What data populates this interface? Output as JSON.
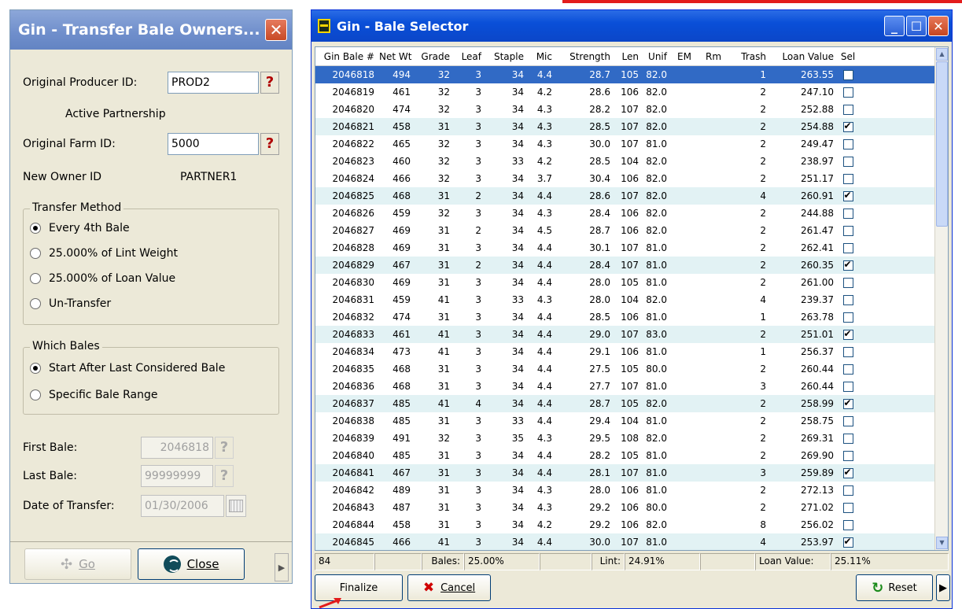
{
  "transfer_window": {
    "title": "Gin - Transfer Bale Owners...",
    "close_glyph": "✕",
    "original_producer_label": "Original Producer ID:",
    "original_producer_value": "PROD2",
    "partnership_text": "Active Partnership",
    "original_farm_label": "Original Farm ID:",
    "original_farm_value": "5000",
    "new_owner_label": "New Owner ID",
    "new_owner_value": "PARTNER1",
    "lookup_glyph": "?",
    "transfer_method": {
      "legend": "Transfer Method",
      "options": [
        "Every 4th Bale",
        "25.000% of Lint Weight",
        "25.000% of Loan Value",
        "Un-Transfer"
      ],
      "selected_index": 0
    },
    "which_bales": {
      "legend": "Which Bales",
      "options": [
        "Start After Last Considered Bale",
        "Specific Bale Range"
      ],
      "selected_index": 0
    },
    "first_bale_label": "First Bale:",
    "first_bale_value": "2046818",
    "last_bale_label": "Last Bale:",
    "last_bale_value": "99999999",
    "date_label": "Date of Transfer:",
    "date_value": "01/30/2006",
    "go_label": "Go",
    "close_label": "Close"
  },
  "selector_window": {
    "title": "Gin - Bale Selector",
    "columns": [
      "Gin Bale #",
      "Net Wt",
      "Grade",
      "Leaf",
      "Staple",
      "Mic",
      "Strength",
      "Len",
      "Unif",
      "EM",
      "Rm",
      "Trash",
      "Loan Value",
      "Sel"
    ],
    "rows": [
      [
        "2046818",
        "494",
        "32",
        "3",
        "34",
        "4.4",
        "28.7",
        "105",
        "82.0",
        "",
        "",
        "1",
        "263.55",
        false
      ],
      [
        "2046819",
        "461",
        "32",
        "3",
        "34",
        "4.2",
        "28.6",
        "106",
        "82.0",
        "",
        "",
        "2",
        "247.10",
        false
      ],
      [
        "2046820",
        "474",
        "32",
        "3",
        "34",
        "4.3",
        "28.2",
        "107",
        "82.0",
        "",
        "",
        "2",
        "252.88",
        false
      ],
      [
        "2046821",
        "458",
        "31",
        "3",
        "34",
        "4.3",
        "28.5",
        "107",
        "82.0",
        "",
        "",
        "2",
        "254.88",
        true
      ],
      [
        "2046822",
        "465",
        "32",
        "3",
        "34",
        "4.3",
        "30.0",
        "107",
        "81.0",
        "",
        "",
        "2",
        "249.47",
        false
      ],
      [
        "2046823",
        "460",
        "32",
        "3",
        "33",
        "4.2",
        "28.5",
        "104",
        "82.0",
        "",
        "",
        "2",
        "238.97",
        false
      ],
      [
        "2046824",
        "466",
        "32",
        "3",
        "34",
        "3.7",
        "30.4",
        "106",
        "82.0",
        "",
        "",
        "2",
        "251.17",
        false
      ],
      [
        "2046825",
        "468",
        "31",
        "2",
        "34",
        "4.4",
        "28.6",
        "107",
        "82.0",
        "",
        "",
        "4",
        "260.91",
        true
      ],
      [
        "2046826",
        "459",
        "32",
        "3",
        "34",
        "4.3",
        "28.4",
        "106",
        "82.0",
        "",
        "",
        "2",
        "244.88",
        false
      ],
      [
        "2046827",
        "469",
        "31",
        "2",
        "34",
        "4.5",
        "28.7",
        "106",
        "82.0",
        "",
        "",
        "2",
        "261.47",
        false
      ],
      [
        "2046828",
        "469",
        "31",
        "3",
        "34",
        "4.4",
        "30.1",
        "107",
        "81.0",
        "",
        "",
        "2",
        "262.41",
        false
      ],
      [
        "2046829",
        "467",
        "31",
        "2",
        "34",
        "4.4",
        "28.4",
        "107",
        "81.0",
        "",
        "",
        "2",
        "260.35",
        true
      ],
      [
        "2046830",
        "469",
        "31",
        "3",
        "34",
        "4.4",
        "28.0",
        "105",
        "81.0",
        "",
        "",
        "2",
        "261.00",
        false
      ],
      [
        "2046831",
        "459",
        "41",
        "3",
        "33",
        "4.3",
        "28.0",
        "104",
        "82.0",
        "",
        "",
        "4",
        "239.37",
        false
      ],
      [
        "2046832",
        "474",
        "31",
        "3",
        "34",
        "4.4",
        "28.5",
        "106",
        "81.0",
        "",
        "",
        "1",
        "263.78",
        false
      ],
      [
        "2046833",
        "461",
        "41",
        "3",
        "34",
        "4.4",
        "29.0",
        "107",
        "83.0",
        "",
        "",
        "2",
        "251.01",
        true
      ],
      [
        "2046834",
        "473",
        "41",
        "3",
        "34",
        "4.4",
        "29.1",
        "106",
        "81.0",
        "",
        "",
        "1",
        "256.37",
        false
      ],
      [
        "2046835",
        "468",
        "31",
        "3",
        "34",
        "4.4",
        "27.5",
        "105",
        "80.0",
        "",
        "",
        "2",
        "260.44",
        false
      ],
      [
        "2046836",
        "468",
        "31",
        "3",
        "34",
        "4.4",
        "27.7",
        "107",
        "81.0",
        "",
        "",
        "3",
        "260.44",
        false
      ],
      [
        "2046837",
        "485",
        "41",
        "4",
        "34",
        "4.4",
        "28.7",
        "105",
        "82.0",
        "",
        "",
        "2",
        "258.99",
        true
      ],
      [
        "2046838",
        "485",
        "31",
        "3",
        "33",
        "4.4",
        "29.4",
        "104",
        "81.0",
        "",
        "",
        "2",
        "258.75",
        false
      ],
      [
        "2046839",
        "491",
        "32",
        "3",
        "35",
        "4.3",
        "29.5",
        "108",
        "82.0",
        "",
        "",
        "2",
        "269.31",
        false
      ],
      [
        "2046840",
        "485",
        "31",
        "3",
        "34",
        "4.4",
        "28.2",
        "105",
        "81.0",
        "",
        "",
        "2",
        "269.90",
        false
      ],
      [
        "2046841",
        "467",
        "31",
        "3",
        "34",
        "4.4",
        "28.1",
        "107",
        "81.0",
        "",
        "",
        "3",
        "259.89",
        true
      ],
      [
        "2046842",
        "489",
        "31",
        "3",
        "34",
        "4.3",
        "28.0",
        "106",
        "81.0",
        "",
        "",
        "2",
        "272.13",
        false
      ],
      [
        "2046843",
        "487",
        "31",
        "3",
        "34",
        "4.3",
        "29.2",
        "106",
        "80.0",
        "",
        "",
        "2",
        "271.02",
        false
      ],
      [
        "2046844",
        "458",
        "31",
        "3",
        "34",
        "4.2",
        "29.2",
        "106",
        "82.0",
        "",
        "",
        "8",
        "256.02",
        false
      ],
      [
        "2046845",
        "466",
        "41",
        "3",
        "34",
        "4.4",
        "30.0",
        "107",
        "81.0",
        "",
        "",
        "4",
        "253.97",
        true
      ]
    ],
    "selected_row_index": 0,
    "status": {
      "count": "84",
      "bales_label": "Bales:",
      "bales_value": "25.00%",
      "lint_label": "Lint:",
      "lint_value": "24.91%",
      "loan_label": "Loan Value:",
      "loan_value": "25.11%"
    },
    "finalize_label": "Finalize",
    "cancel_label": "Cancel",
    "reset_label": "Reset"
  },
  "colors": {
    "selected_row": "#316ac5",
    "alt_row": "#e2f2f4",
    "title_blue": "#0a4fd8",
    "banner_red": "#e31c1c"
  }
}
